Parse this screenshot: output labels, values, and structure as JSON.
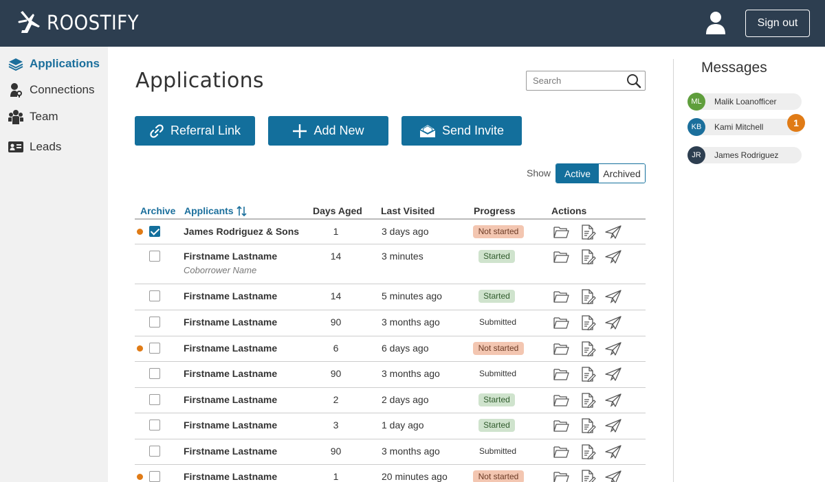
{
  "brand": {
    "name": "ROOSTIFY"
  },
  "header": {
    "sign_out": "Sign out",
    "user_icon": "user-icon"
  },
  "sidebar": {
    "items": [
      {
        "label": "Applications",
        "icon": "layers-icon",
        "active": true
      },
      {
        "label": "Connections",
        "icon": "person-key-icon",
        "active": false
      },
      {
        "label": "Team",
        "icon": "team-icon",
        "active": false
      },
      {
        "label": "Leads",
        "icon": "id-card-icon",
        "active": false
      }
    ]
  },
  "main": {
    "title": "Applications",
    "search": {
      "placeholder": "Search"
    },
    "buttons": {
      "referral": "Referral Link",
      "add_new": "Add New",
      "send_invite": "Send Invite"
    },
    "filter": {
      "label": "Show",
      "active": "Active",
      "archived": "Archived"
    },
    "table": {
      "columns": {
        "archive": "Archive",
        "applicants": "Applicants",
        "days_aged": "Days Aged",
        "last_visited": "Last Visited",
        "progress": "Progress",
        "actions": "Actions"
      },
      "rows": [
        {
          "name": "James Rodriguez & Sons",
          "coborrower": "",
          "days": "1",
          "visited": "3 days ago",
          "progress": "Not started",
          "status": "notstarted",
          "checked": true,
          "flag": true
        },
        {
          "name": "Firstname Lastname",
          "coborrower": "Coborrower Name",
          "days": "14",
          "visited": "3 minutes",
          "progress": "Started",
          "status": "started",
          "checked": false,
          "flag": false
        },
        {
          "name": "Firstname Lastname",
          "coborrower": "",
          "days": "14",
          "visited": "5 minutes ago",
          "progress": "Started",
          "status": "started",
          "checked": false,
          "flag": false
        },
        {
          "name": "Firstname Lastname",
          "coborrower": "",
          "days": "90",
          "visited": "3 months ago",
          "progress": "Submitted",
          "status": "submitted",
          "checked": false,
          "flag": false
        },
        {
          "name": "Firstname Lastname",
          "coborrower": "",
          "days": "6",
          "visited": "6 days ago",
          "progress": "Not started",
          "status": "notstarted",
          "checked": false,
          "flag": true
        },
        {
          "name": "Firstname Lastname",
          "coborrower": "",
          "days": "90",
          "visited": "3 months ago",
          "progress": "Submitted",
          "status": "submitted",
          "checked": false,
          "flag": false
        },
        {
          "name": "Firstname Lastname",
          "coborrower": "",
          "days": "2",
          "visited": "2 days ago",
          "progress": "Started",
          "status": "started",
          "checked": false,
          "flag": false
        },
        {
          "name": "Firstname Lastname",
          "coborrower": "",
          "days": "3",
          "visited": "1 day ago",
          "progress": "Started",
          "status": "started",
          "checked": false,
          "flag": false
        },
        {
          "name": "Firstname Lastname",
          "coborrower": "",
          "days": "90",
          "visited": "3 months ago",
          "progress": "Submitted",
          "status": "submitted",
          "checked": false,
          "flag": false
        },
        {
          "name": "Firstname Lastname",
          "coborrower": "",
          "days": "1",
          "visited": "20 minutes ago",
          "progress": "Not started",
          "status": "notstarted",
          "checked": false,
          "flag": true
        }
      ]
    }
  },
  "messages": {
    "title": "Messages",
    "contacts": [
      {
        "initials": "ML",
        "name": "Malik Loanofficer",
        "color": "#5f9e3c",
        "unread": ""
      },
      {
        "initials": "KB",
        "name": "Kami Mitchell",
        "color": "#1b6f9c",
        "unread": "1"
      },
      {
        "initials": "JR",
        "name": "James Rodriguez",
        "color": "#2d3e50",
        "unread": ""
      }
    ]
  },
  "colors": {
    "header_bg": "#2d3e50",
    "primary": "#136f9c",
    "flag": "#e07b16",
    "not_started_bg": "#f3c6b1",
    "started_bg": "#cfe3cd"
  }
}
